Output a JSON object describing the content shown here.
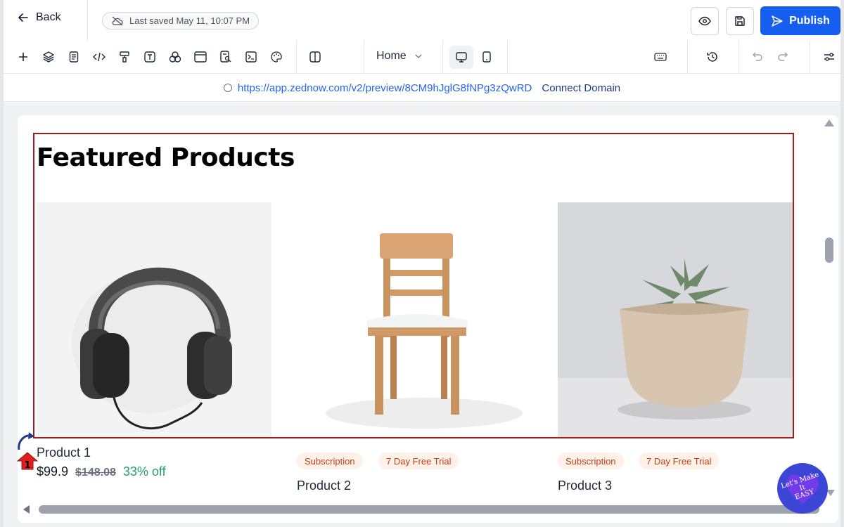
{
  "topbar": {
    "back_label": "Back",
    "saved_text": "Last saved May 11, 10:07 PM",
    "publish_label": "Publish",
    "accent": "#155eef"
  },
  "toolbar": {
    "page_selected": "Home",
    "icons": [
      "plus-icon",
      "layers-icon",
      "page-icon",
      "code-icon",
      "paint-roller-icon",
      "text-icon",
      "elements-icon",
      "browser-icon",
      "search-page-icon",
      "terminal-icon",
      "palette-icon",
      "columns-icon",
      "desktop-icon",
      "mobile-icon",
      "keyboard-icon",
      "history-icon",
      "undo-icon",
      "redo-icon",
      "settings-sliders-icon"
    ]
  },
  "urlbar": {
    "url": "https://app.zednow.com/v2/preview/8CM9hJglG8fNPg3zQwRD",
    "connect_label": "Connect Domain"
  },
  "section": {
    "title": "Featured Products"
  },
  "products": [
    {
      "name": "Product 1",
      "price": "$99.9",
      "old_price": "$148.08",
      "discount": "33% off"
    },
    {
      "name": "Product 2",
      "badges": [
        "Subscription",
        "7 Day Free Trial"
      ]
    },
    {
      "name": "Product 3",
      "badges": [
        "Subscription",
        "7 Day Free Trial"
      ]
    }
  ],
  "marker": {
    "number": "1"
  },
  "helper": {
    "text_line1": "Let's Make",
    "text_line2": "It",
    "text_line3": "EASY"
  }
}
